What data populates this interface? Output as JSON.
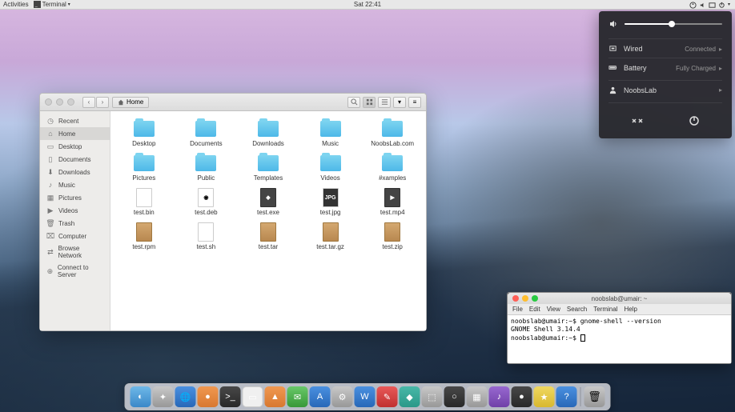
{
  "topbar": {
    "activities": "Activities",
    "app": "Terminal",
    "clock": "Sat 22:41"
  },
  "syspanel": {
    "network_label": "Wired",
    "network_status": "Connected",
    "battery_label": "Battery",
    "battery_status": "Fully Charged",
    "user": "NoobsLab"
  },
  "filewin": {
    "path": "Home",
    "sidebar": [
      {
        "icon": "clock",
        "label": "Recent"
      },
      {
        "icon": "home",
        "label": "Home"
      },
      {
        "icon": "desktop",
        "label": "Desktop"
      },
      {
        "icon": "doc",
        "label": "Documents"
      },
      {
        "icon": "down",
        "label": "Downloads"
      },
      {
        "icon": "music",
        "label": "Music"
      },
      {
        "icon": "pic",
        "label": "Pictures"
      },
      {
        "icon": "vid",
        "label": "Videos"
      },
      {
        "icon": "trash",
        "label": "Trash"
      },
      {
        "icon": "comp",
        "label": "Computer"
      },
      {
        "icon": "net",
        "label": "Browse Network"
      },
      {
        "icon": "srv",
        "label": "Connect to Server"
      }
    ],
    "items": [
      {
        "type": "folder",
        "label": "Desktop"
      },
      {
        "type": "folder",
        "label": "Documents"
      },
      {
        "type": "folder",
        "label": "Downloads"
      },
      {
        "type": "folder",
        "label": "Music"
      },
      {
        "type": "folder",
        "label": "NoobsLab.com"
      },
      {
        "type": "folder",
        "label": "Pictures"
      },
      {
        "type": "folder",
        "label": "Public"
      },
      {
        "type": "folder",
        "label": "Templates"
      },
      {
        "type": "folder",
        "label": "Videos"
      },
      {
        "type": "folder",
        "label": "#xamples"
      },
      {
        "type": "file-bin",
        "label": "test.bin"
      },
      {
        "type": "file-deb",
        "label": "test.deb"
      },
      {
        "type": "file-exe",
        "label": "test.exe"
      },
      {
        "type": "file-jpg",
        "label": "test.jpg"
      },
      {
        "type": "file-mp4",
        "label": "test.mp4"
      },
      {
        "type": "file-box",
        "label": "test.rpm"
      },
      {
        "type": "file-sh",
        "label": "test.sh"
      },
      {
        "type": "file-box",
        "label": "test.tar"
      },
      {
        "type": "file-box",
        "label": "test.tar.gz"
      },
      {
        "type": "file-box",
        "label": "test.zip"
      }
    ]
  },
  "terminal": {
    "title": "noobslab@umair: ~",
    "menu": [
      "File",
      "Edit",
      "View",
      "Search",
      "Terminal",
      "Help"
    ],
    "lines": [
      "noobslab@umair:~$ gnome-shell --version",
      "GNOME Shell 3.14.4",
      "noobslab@umair:~$ "
    ]
  },
  "dock": {
    "items": [
      {
        "name": "finder",
        "cls": "di-finder",
        "glyph": "◐"
      },
      {
        "name": "safari",
        "cls": "di-gray",
        "glyph": "✦"
      },
      {
        "name": "globe",
        "cls": "di-blue",
        "glyph": "🌐"
      },
      {
        "name": "firefox",
        "cls": "di-orange",
        "glyph": "●"
      },
      {
        "name": "terminal",
        "cls": "di-dark",
        "glyph": ">_"
      },
      {
        "name": "files",
        "cls": "di-white",
        "glyph": "▭"
      },
      {
        "name": "vlc",
        "cls": "di-orange",
        "glyph": "▲"
      },
      {
        "name": "chat",
        "cls": "di-green",
        "glyph": "✉"
      },
      {
        "name": "appstore",
        "cls": "di-blue",
        "glyph": "A"
      },
      {
        "name": "settings",
        "cls": "di-gray",
        "glyph": "⚙"
      },
      {
        "name": "writer",
        "cls": "di-blue",
        "glyph": "W"
      },
      {
        "name": "tool1",
        "cls": "di-red",
        "glyph": "✎"
      },
      {
        "name": "tool2",
        "cls": "di-teal",
        "glyph": "◆"
      },
      {
        "name": "tool3",
        "cls": "di-gray",
        "glyph": "⬚"
      },
      {
        "name": "tool4",
        "cls": "di-dark",
        "glyph": "○"
      },
      {
        "name": "tool5",
        "cls": "di-gray",
        "glyph": "▦"
      },
      {
        "name": "tool6",
        "cls": "di-purple",
        "glyph": "♪"
      },
      {
        "name": "tool7",
        "cls": "di-dark",
        "glyph": "●"
      },
      {
        "name": "tool8",
        "cls": "di-yellow",
        "glyph": "★"
      },
      {
        "name": "help",
        "cls": "di-blue",
        "glyph": "?"
      }
    ],
    "trash": {
      "name": "trash",
      "cls": "di-gray",
      "glyph": "🗑"
    }
  }
}
